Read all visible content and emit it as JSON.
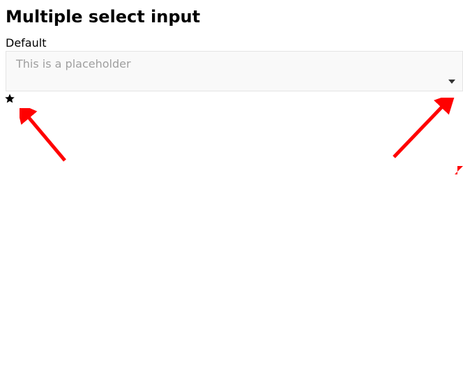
{
  "page": {
    "title": "Multiple select input"
  },
  "field": {
    "label": "Default",
    "placeholder": "This is a placeholder"
  },
  "annotations": {
    "arrow_color": "#ff0000"
  }
}
